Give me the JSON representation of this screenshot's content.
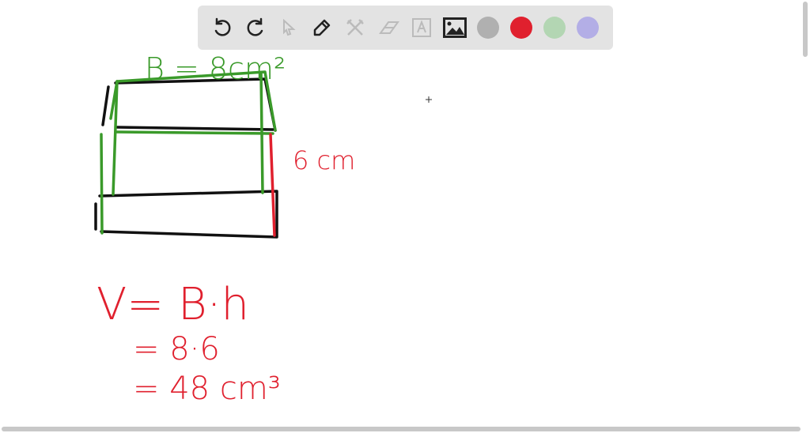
{
  "toolbar": {
    "tools": [
      "undo-icon",
      "redo-icon",
      "select-icon",
      "pen-icon",
      "tools-icon",
      "eraser-icon",
      "text-icon",
      "image-icon"
    ],
    "colors": {
      "gray": "#b0b0b0",
      "red": "#e0202e",
      "green": "#b3d6b3",
      "purple": "#b3aee6"
    }
  },
  "drawing": {
    "base_label": "B = 8cm²",
    "height_label": "6 cm",
    "formula": "V= B·h",
    "step1": "= 8·6",
    "step2": "= 48  cm³"
  }
}
